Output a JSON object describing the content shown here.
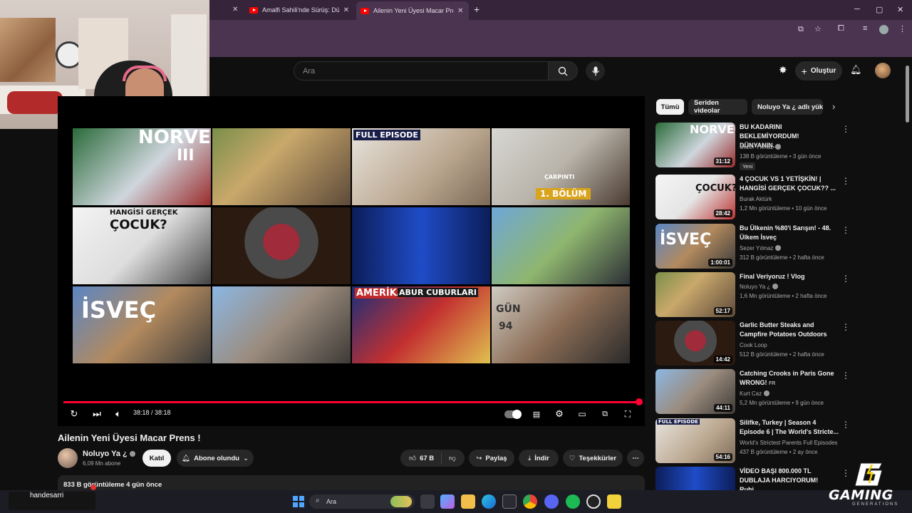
{
  "browser": {
    "tabs": [
      {
        "label": "Amalfi Sahili'nde Sürüş: Dünyan"
      },
      {
        "label": "Ailenin Yeni Üyesi Macar Prens"
      }
    ],
    "new_tab": "+"
  },
  "header": {
    "search_placeholder": "Ara",
    "create_label": "Oluştur"
  },
  "player": {
    "time": "38:18 / 38:18",
    "progress": 1.0
  },
  "video": {
    "title": "Ailenin Yeni Üyesi Macar Prens !",
    "channel": "Noluyo Ya ¿",
    "subscribers": "6,09 Mn abone",
    "join_label": "Katıl",
    "subscribed_label": "Abone olundu",
    "likes": "67 B",
    "share_label": "Paylaş",
    "download_label": "İndir",
    "thanks_label": "Teşekkürler",
    "views_line": "833 B görüntüleme  4 gün önce"
  },
  "end_screen": {
    "thumbs": [
      {
        "text": "NORVEÇ",
        "sub": "III"
      },
      {
        "text": ""
      },
      {
        "text": "FULL EPISODE"
      },
      {
        "text": "1. BÖLÜM",
        "sub": "ÇARPINTI"
      },
      {
        "text": "HANGİSİ GERÇEK",
        "sub": "ÇOCUK?"
      },
      {
        "text": ""
      },
      {
        "text": ""
      },
      {
        "text": ""
      },
      {
        "text": "İSVEÇ"
      },
      {
        "text": ""
      },
      {
        "text": "AMERİKA",
        "sub": "ABUR CUBURLARI"
      },
      {
        "text": "GÜN",
        "sub": "94"
      }
    ]
  },
  "sidebar": {
    "chips": [
      "Tümü",
      "Seriden videolar",
      "Noluyo Ya ¿ adlı yükle"
    ],
    "recommendations": [
      {
        "title": "BU KADARINI BEKLEMİYORDUM! DÜNYANIN...",
        "channel": "Sezer Yılmaz",
        "meta": "138 B görüntüleme • 3 gün önce",
        "badge": "Yeni",
        "duration": "31:12",
        "thumb_text": "NORVEÇ"
      },
      {
        "title": "4 ÇOCUK VS 1 YETİŞKİN! | HANGİSİ GERÇEK ÇOCUK?? ...",
        "channel": "Burak Aktürk",
        "meta": "1,2 Mn görüntüleme • 10 gün önce",
        "duration": "28:42",
        "thumb_text": "ÇOCUK?"
      },
      {
        "title": "Bu Ülkenin %80'i Sarışın! - 48. Ülkem İsveç",
        "channel": "Sezer Yılmaz",
        "meta": "312 B görüntüleme • 2 hafta önce",
        "duration": "1:00:01",
        "thumb_text": "İSVEÇ"
      },
      {
        "title": "Final Veriyoruz ! Vlog",
        "channel": "Noluyo Ya ¿",
        "meta": "1,6 Mn görüntüleme • 2 hafta önce",
        "duration": "52:17",
        "thumb_text": ""
      },
      {
        "title": "Garlic Butter Steaks and Campfire Potatoes Outdoors",
        "channel": "Cook Loop",
        "meta": "512 B görüntüleme • 2 hafta önce",
        "duration": "14:42",
        "thumb_text": ""
      },
      {
        "title": "Catching Crooks in Paris Gone WRONG!",
        "title_tag": "FR",
        "channel": "Kurt Caz",
        "meta": "5,2 Mn görüntüleme • 9 gün önce",
        "duration": "44:11",
        "thumb_text": ""
      },
      {
        "title": "Silifke, Turkey | Season 4 Episode 6 | The World's Stricte...",
        "channel": "World's Strictest Parents Full Episodes",
        "meta": "437 B görüntüleme • 2 ay önce",
        "duration": "54:16",
        "thumb_text": "FULL EPISODE"
      },
      {
        "title": "VİDEO BAŞI 800.000 TL DUBLAJA HARCIYORUM! Ruhi...",
        "channel": "",
        "meta": "",
        "duration": "",
        "thumb_text": ""
      }
    ]
  },
  "taskbar": {
    "search_label": "Ara",
    "streamer_name": "handesarri"
  },
  "overlay": {
    "brand": "GAMING",
    "brand_sub": "GENERATIONS"
  },
  "colors": {
    "accent": "#ff0033",
    "background": "#0f0f0f",
    "chrome": "#4a344f"
  }
}
